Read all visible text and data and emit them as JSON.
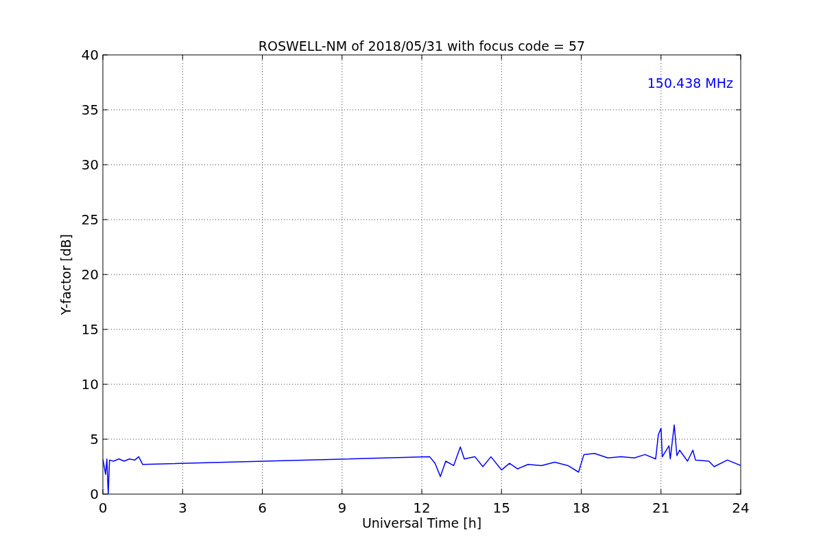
{
  "chart_data": {
    "type": "line",
    "title": "ROSWELL-NM of 2018/05/31 with focus code = 57",
    "xlabel": "Universal Time [h]",
    "ylabel": "Y-factor [dB]",
    "x": [
      0,
      0.1,
      0.15,
      0.2,
      0.25,
      0.4,
      0.6,
      0.8,
      1.0,
      1.2,
      1.35,
      1.5,
      12.3,
      12.5,
      12.7,
      12.9,
      13.2,
      13.45,
      13.6,
      14.0,
      14.3,
      14.6,
      15.0,
      15.3,
      15.6,
      16.0,
      16.5,
      17.0,
      17.5,
      17.9,
      18.1,
      18.5,
      19.0,
      19.5,
      20.0,
      20.4,
      20.8,
      20.9,
      21.0,
      21.05,
      21.3,
      21.35,
      21.5,
      21.6,
      21.7,
      22.0,
      22.2,
      22.3,
      22.8,
      23.0,
      23.5,
      24.0
    ],
    "series": [
      {
        "name": "150.438 MHz",
        "color": "#0000ff",
        "values": [
          3.2,
          1.8,
          3.2,
          0,
          3.1,
          3.0,
          3.2,
          3.0,
          3.2,
          3.1,
          3.4,
          2.7,
          3.4,
          2.8,
          1.6,
          3.0,
          2.6,
          4.3,
          3.2,
          3.4,
          2.5,
          3.4,
          2.2,
          2.8,
          2.3,
          2.7,
          2.6,
          2.9,
          2.6,
          2.0,
          3.6,
          3.7,
          3.3,
          3.4,
          3.3,
          3.6,
          3.2,
          5.4,
          6.0,
          3.4,
          4.4,
          3.2,
          6.3,
          3.5,
          4.0,
          3.0,
          4.0,
          3.1,
          3.0,
          2.5,
          3.1,
          2.6
        ]
      }
    ],
    "xlim": [
      0,
      24
    ],
    "ylim": [
      0,
      40
    ],
    "xticks": [
      0,
      3,
      6,
      9,
      12,
      15,
      18,
      21,
      24
    ],
    "yticks": [
      0,
      5,
      10,
      15,
      20,
      25,
      30,
      35,
      40
    ],
    "grid": true
  }
}
